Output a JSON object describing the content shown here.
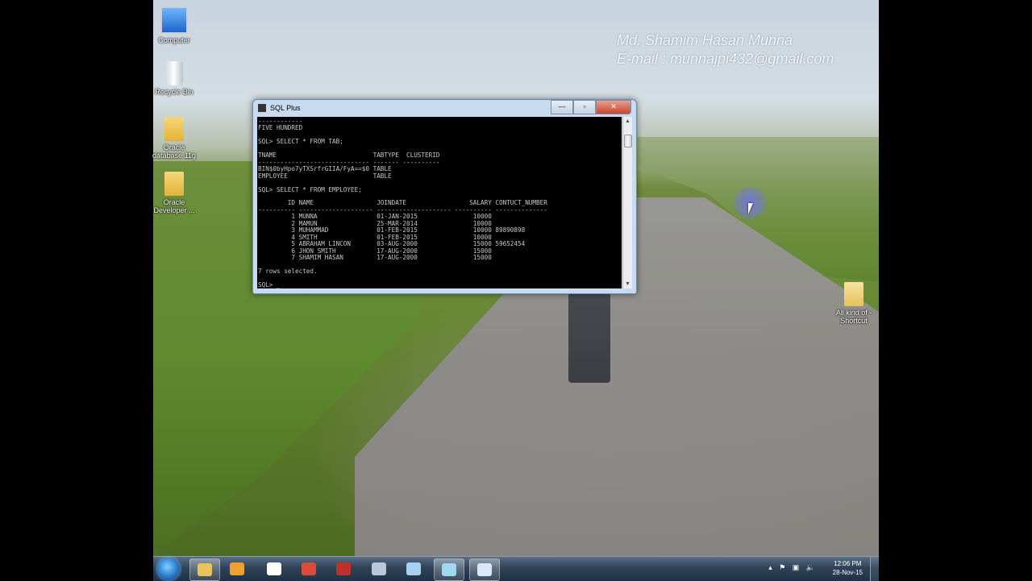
{
  "watermark": {
    "name": "Md. Shamim Hasan Munna",
    "email": "E-mail : munnajpi432@gmail.com"
  },
  "desktop_icons": [
    {
      "label": "Computer",
      "icon": "computer-icon"
    },
    {
      "label": "Recycle Bin",
      "icon": "recycle-bin-icon"
    },
    {
      "label": "Oracle database 11g",
      "icon": "folder-icon"
    },
    {
      "label": "Oracle Developer ...",
      "icon": "folder-icon"
    },
    {
      "label": "All kind of - Shortcut",
      "icon": "folder-shortcut-icon"
    }
  ],
  "window": {
    "title": "SQL Plus",
    "minimize": "—",
    "maximize": "▫",
    "close": "✕"
  },
  "console": {
    "lines": [
      "------------",
      "FIVE HUNDRED",
      "",
      "SQL> SELECT * FROM TAB;",
      "",
      "TNAME                          TABTYPE  CLUSTERID",
      "------------------------------ ------- ----------",
      "BIN$0byHpo7yTXSrfrGIIA/FyA==$0 TABLE",
      "EMPLOYEE                       TABLE",
      "",
      "SQL> SELECT * FROM EMPLOYEE;",
      "",
      "        ID NAME                 JOINDATE                 SALARY CONTUCT_NUMBER",
      "---------- -------------------- -------------------- ---------- --------------",
      "         1 MUNNA                01-JAN-2015               10000",
      "         2 MAMUN                25-MAR-2014               10000",
      "         3 MUHAMMAD             01-FEB-2015               10000 89890898",
      "         4 SMITH                01-FEB-2015               10000",
      "         5 ABRAHAM LINCON       03-AUG-2000               15000 59652454",
      "         6 JHON SMITH           17-AUG-2000               15000",
      "         7 SHAMIM HASAN         17-AUG-2000               15000",
      "",
      "7 rows selected.",
      "",
      "SQL> _"
    ]
  },
  "taskbar": {
    "items": [
      {
        "icon": "explorer-icon",
        "color": "#e9c45a",
        "active": true
      },
      {
        "icon": "media-player-icon",
        "color": "#f0a030",
        "active": false
      },
      {
        "icon": "panda-icon",
        "color": "#ffffff",
        "active": false
      },
      {
        "icon": "chrome-icon",
        "color": "#d94b3a",
        "active": false
      },
      {
        "icon": "book-icon",
        "color": "#c0302a",
        "active": false
      },
      {
        "icon": "calculator-icon",
        "color": "#b8c8d8",
        "active": false
      },
      {
        "icon": "paint-icon",
        "color": "#a8d0f0",
        "active": false
      },
      {
        "icon": "app-window-icon",
        "color": "#a0d8f0",
        "active": true
      },
      {
        "icon": "sqlplus-icon",
        "color": "#d8e8f8",
        "active": true
      }
    ],
    "time": "12:06 PM",
    "date": "28-Nov-15"
  },
  "colors": {
    "console_bg": "#000000",
    "console_text": "#c8c8c8",
    "taskbar": "#2f4257"
  }
}
